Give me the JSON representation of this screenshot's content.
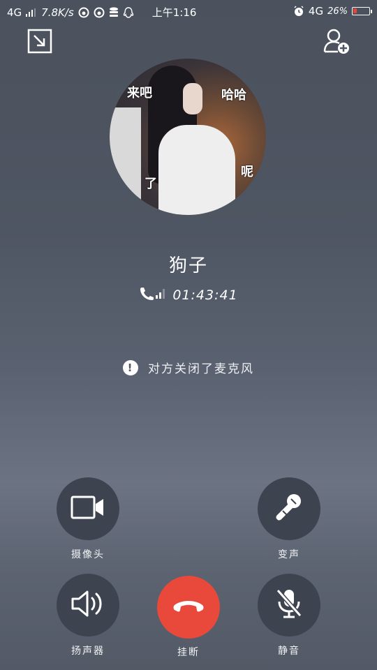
{
  "status_bar": {
    "network_left": "4G",
    "speed": "7.8K/s",
    "time": "上午1:16",
    "network_right": "4G",
    "battery": "26%",
    "battery_level": 0.26,
    "icons": [
      "signal-icon",
      "app-icon",
      "app-icon",
      "database-icon",
      "qq-icon",
      "alarm-icon",
      "battery-icon"
    ]
  },
  "header": {
    "minimize_icon": "minimize-icon",
    "add_contact_icon": "add-contact-icon"
  },
  "contact": {
    "name": "狗子",
    "avatar_text_1": "哈哈",
    "avatar_text_2": "来吧",
    "avatar_text_3": "了",
    "avatar_text_4": "呢"
  },
  "call": {
    "timer": "01:43:41",
    "signal_icon": "call-signal-icon"
  },
  "notice": {
    "text": "对方关闭了麦克风",
    "icon": "warning-icon"
  },
  "controls": {
    "camera_label": "摄像头",
    "voice_changer_label": "变声",
    "speaker_label": "扬声器",
    "hangup_label": "挂断",
    "mute_label": "静音"
  },
  "colors": {
    "hangup": "#e8493a",
    "control_bg": "#3d4450",
    "background": "#4f5663"
  }
}
